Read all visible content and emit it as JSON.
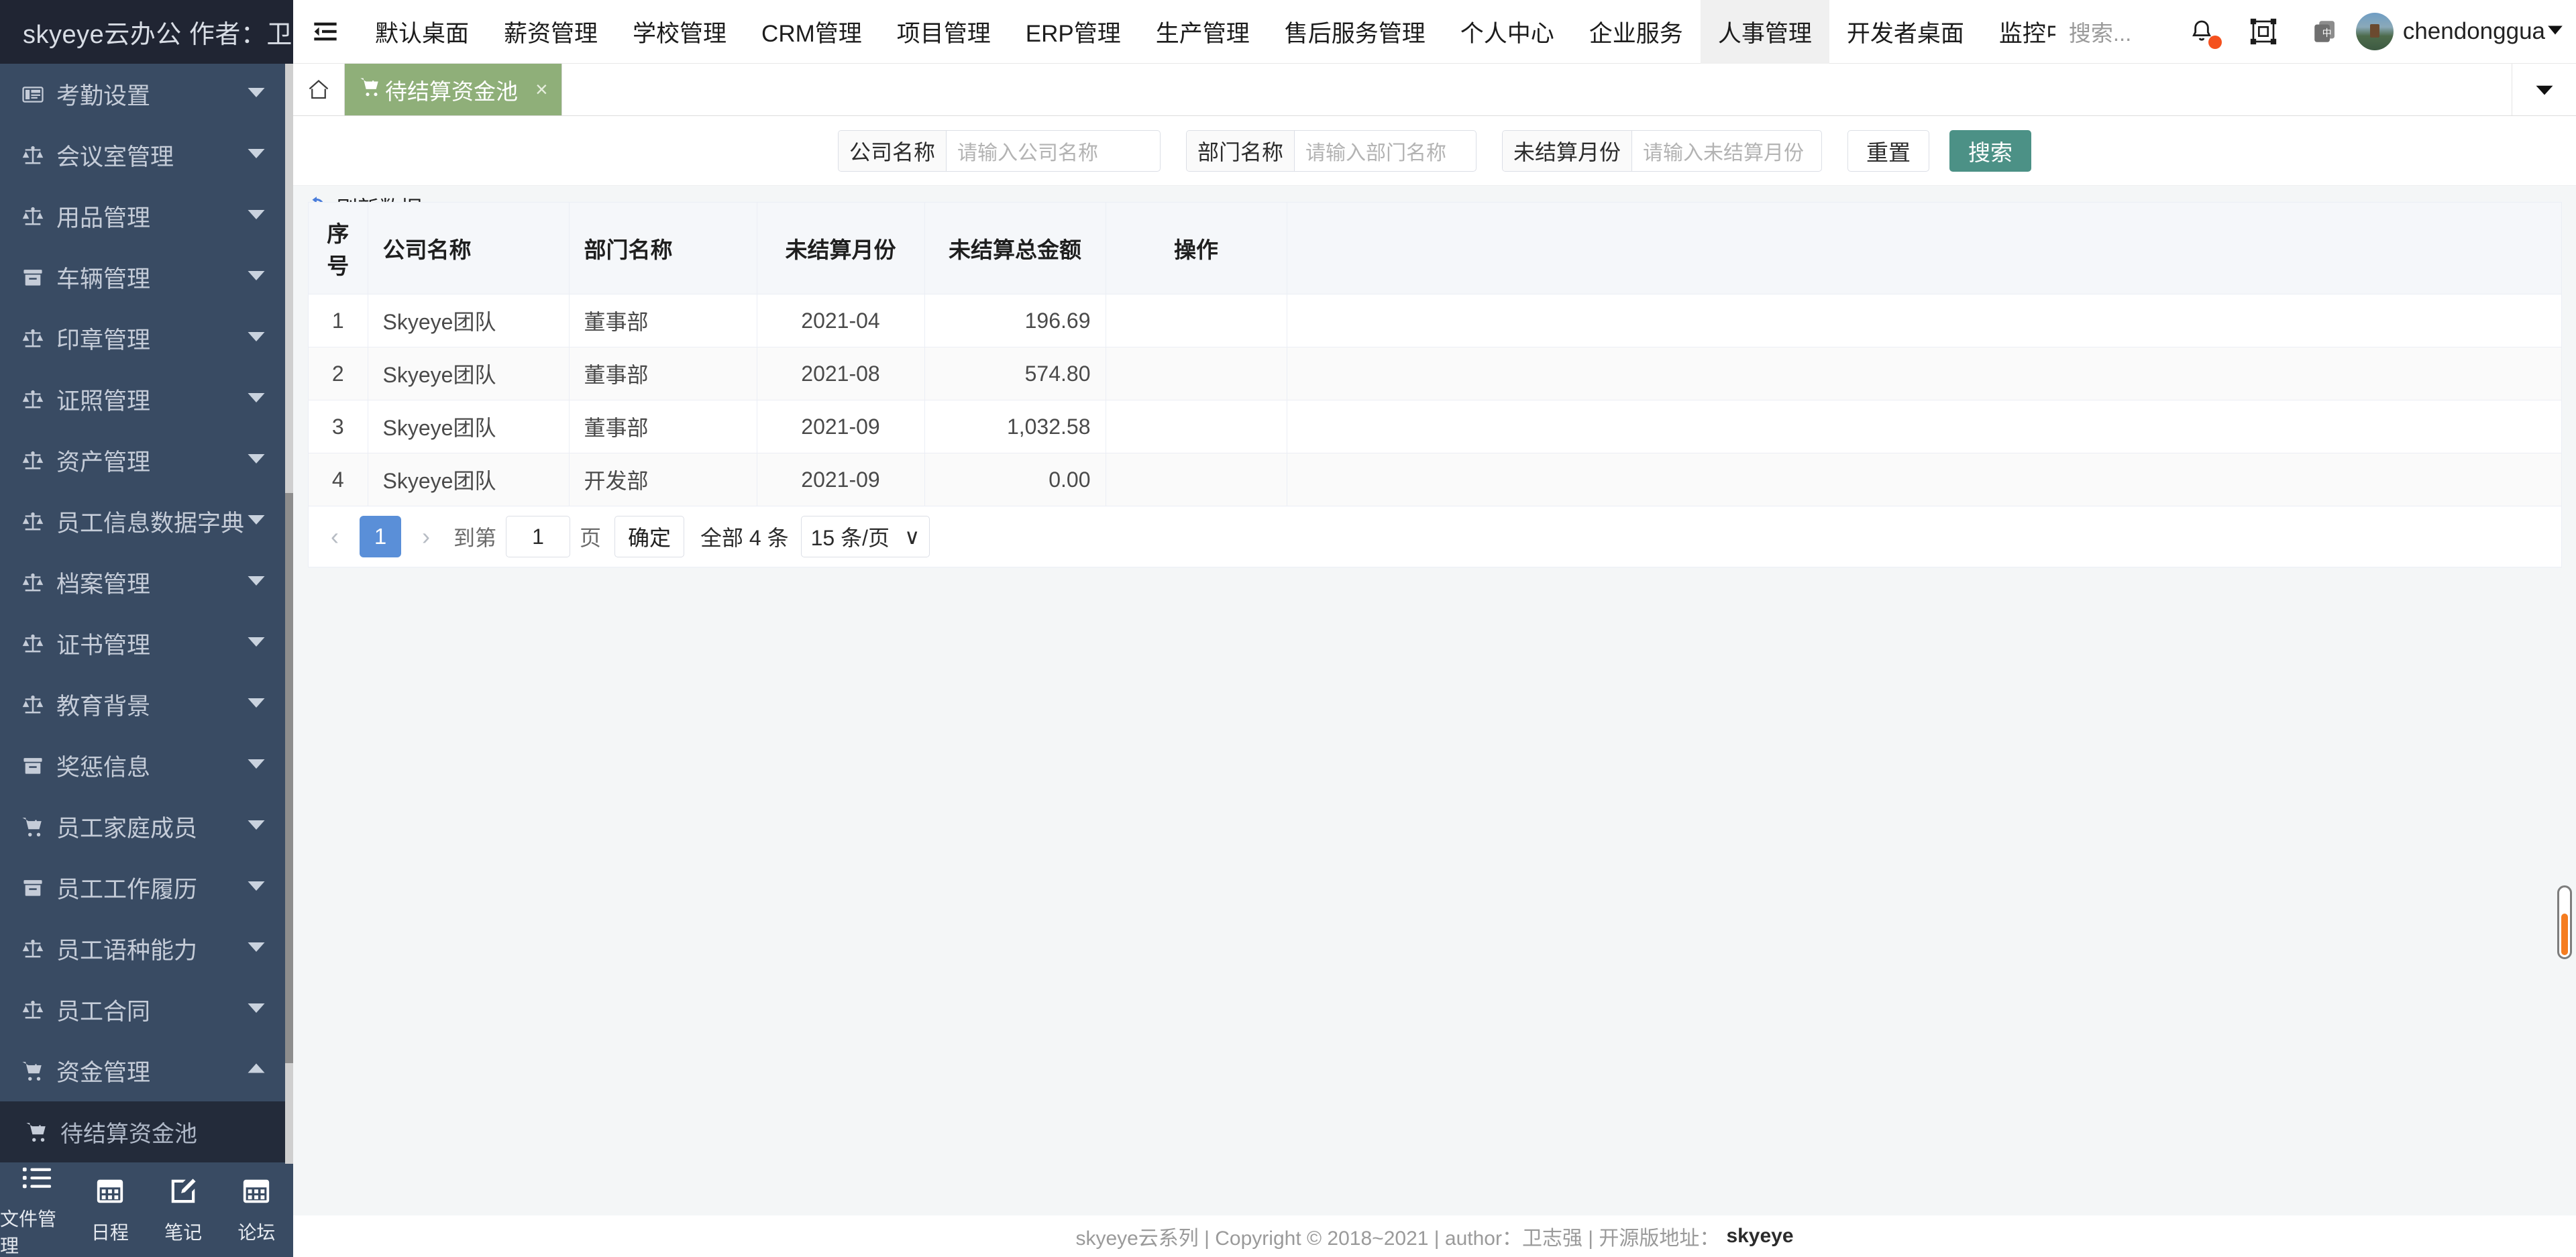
{
  "brand": {
    "title": "skyeye云办公 作者：卫志强"
  },
  "topbar": {
    "menu_icon": "hamburger-icon",
    "tabs": [
      {
        "label": "默认桌面",
        "active": false
      },
      {
        "label": "薪资管理",
        "active": false
      },
      {
        "label": "学校管理",
        "active": false
      },
      {
        "label": "CRM管理",
        "active": false
      },
      {
        "label": "项目管理",
        "active": false
      },
      {
        "label": "ERP管理",
        "active": false
      },
      {
        "label": "生产管理",
        "active": false
      },
      {
        "label": "售后服务管理",
        "active": false
      },
      {
        "label": "个人中心",
        "active": false
      },
      {
        "label": "企业服务",
        "active": false
      },
      {
        "label": "人事管理",
        "active": true
      },
      {
        "label": "开发者桌面",
        "active": false
      },
      {
        "label": "监控中心",
        "active": false
      }
    ],
    "search_placeholder": "搜索...",
    "icons": [
      "bell-icon",
      "fullscreen-icon",
      "language-icon"
    ],
    "notification_dot": true,
    "language_glyph": "中",
    "username": "chendonggua",
    "user_caret": "▼"
  },
  "tabstrip": {
    "home_icon": "home-icon",
    "open_tab": {
      "icon": "cart-icon",
      "label": "待结算资金池",
      "close": "×"
    },
    "overflow_caret": "▼"
  },
  "sidebar": {
    "items": [
      {
        "label": "考勤设置",
        "icon": "id-card-icon",
        "expanded": false
      },
      {
        "label": "会议室管理",
        "icon": "scale-icon",
        "expanded": false
      },
      {
        "label": "用品管理",
        "icon": "scale-icon",
        "expanded": false
      },
      {
        "label": "车辆管理",
        "icon": "archive-icon",
        "expanded": false
      },
      {
        "label": "印章管理",
        "icon": "scale-icon",
        "expanded": false
      },
      {
        "label": "证照管理",
        "icon": "scale-icon",
        "expanded": false
      },
      {
        "label": "资产管理",
        "icon": "scale-icon",
        "expanded": false
      },
      {
        "label": "员工信息数据字典",
        "icon": "scale-icon",
        "expanded": false
      },
      {
        "label": "档案管理",
        "icon": "scale-icon",
        "expanded": false
      },
      {
        "label": "证书管理",
        "icon": "scale-icon",
        "expanded": false
      },
      {
        "label": "教育背景",
        "icon": "scale-icon",
        "expanded": false
      },
      {
        "label": "奖惩信息",
        "icon": "archive-icon",
        "expanded": false
      },
      {
        "label": "员工家庭成员",
        "icon": "cart-icon",
        "expanded": false
      },
      {
        "label": "员工工作履历",
        "icon": "archive-icon",
        "expanded": false
      },
      {
        "label": "员工语种能力",
        "icon": "scale-icon",
        "expanded": false
      },
      {
        "label": "员工合同",
        "icon": "scale-icon",
        "expanded": false
      },
      {
        "label": "资金管理",
        "icon": "cart-icon",
        "expanded": true
      }
    ],
    "sub_item": {
      "label": "待结算资金池",
      "icon": "cart-icon",
      "selected": true
    },
    "bottom": [
      {
        "label": "文件管理",
        "icon": "list-icon"
      },
      {
        "label": "日程",
        "icon": "calendar-icon"
      },
      {
        "label": "笔记",
        "icon": "edit-icon"
      },
      {
        "label": "论坛",
        "icon": "calendar-icon"
      }
    ]
  },
  "search_form": {
    "fields": [
      {
        "label": "公司名称",
        "value": "",
        "placeholder": "请输入公司名称"
      },
      {
        "label": "部门名称",
        "value": "",
        "placeholder": "请输入部门名称"
      },
      {
        "label": "未结算月份",
        "value": "",
        "placeholder": "请输入未结算月份"
      }
    ],
    "reset_label": "重置",
    "search_label": "搜索"
  },
  "toolbar": {
    "refresh_label": "刷新数据",
    "refresh_icon": "refresh-icon"
  },
  "table": {
    "columns": [
      "序号",
      "公司名称",
      "部门名称",
      "未结算月份",
      "未结算总金额",
      "操作"
    ],
    "rows": [
      {
        "idx": "1",
        "company": "Skyeye团队",
        "dept": "董事部",
        "month": "2021-04",
        "amount": "196.69",
        "op": ""
      },
      {
        "idx": "2",
        "company": "Skyeye团队",
        "dept": "董事部",
        "month": "2021-08",
        "amount": "574.80",
        "op": ""
      },
      {
        "idx": "3",
        "company": "Skyeye团队",
        "dept": "董事部",
        "month": "2021-09",
        "amount": "1,032.58",
        "op": ""
      },
      {
        "idx": "4",
        "company": "Skyeye团队",
        "dept": "开发部",
        "month": "2021-09",
        "amount": "0.00",
        "op": ""
      }
    ]
  },
  "pagination": {
    "prev": "‹",
    "current_page": "1",
    "next": "›",
    "goto_label": "到第",
    "goto_value": "1",
    "page_unit": "页",
    "confirm_label": "确定",
    "total_label": "全部 4 条",
    "page_size": "15 条/页",
    "page_size_caret": "∨"
  },
  "footer": {
    "text": "skyeye云系列 | Copyright © 2018~2021 | author：卫志强 | 开源版地址：",
    "link": "skyeye"
  },
  "colors": {
    "sidebar_bg": "#394b63",
    "brand_bg": "#202533",
    "tab_green": "#8faf79",
    "search_btn": "#4c9186",
    "page_blue": "#5a8fd8",
    "refresh_blue": "#4a7ddb",
    "scrollbar_orange": "#f57c1f",
    "notification_red": "#f4511e"
  }
}
